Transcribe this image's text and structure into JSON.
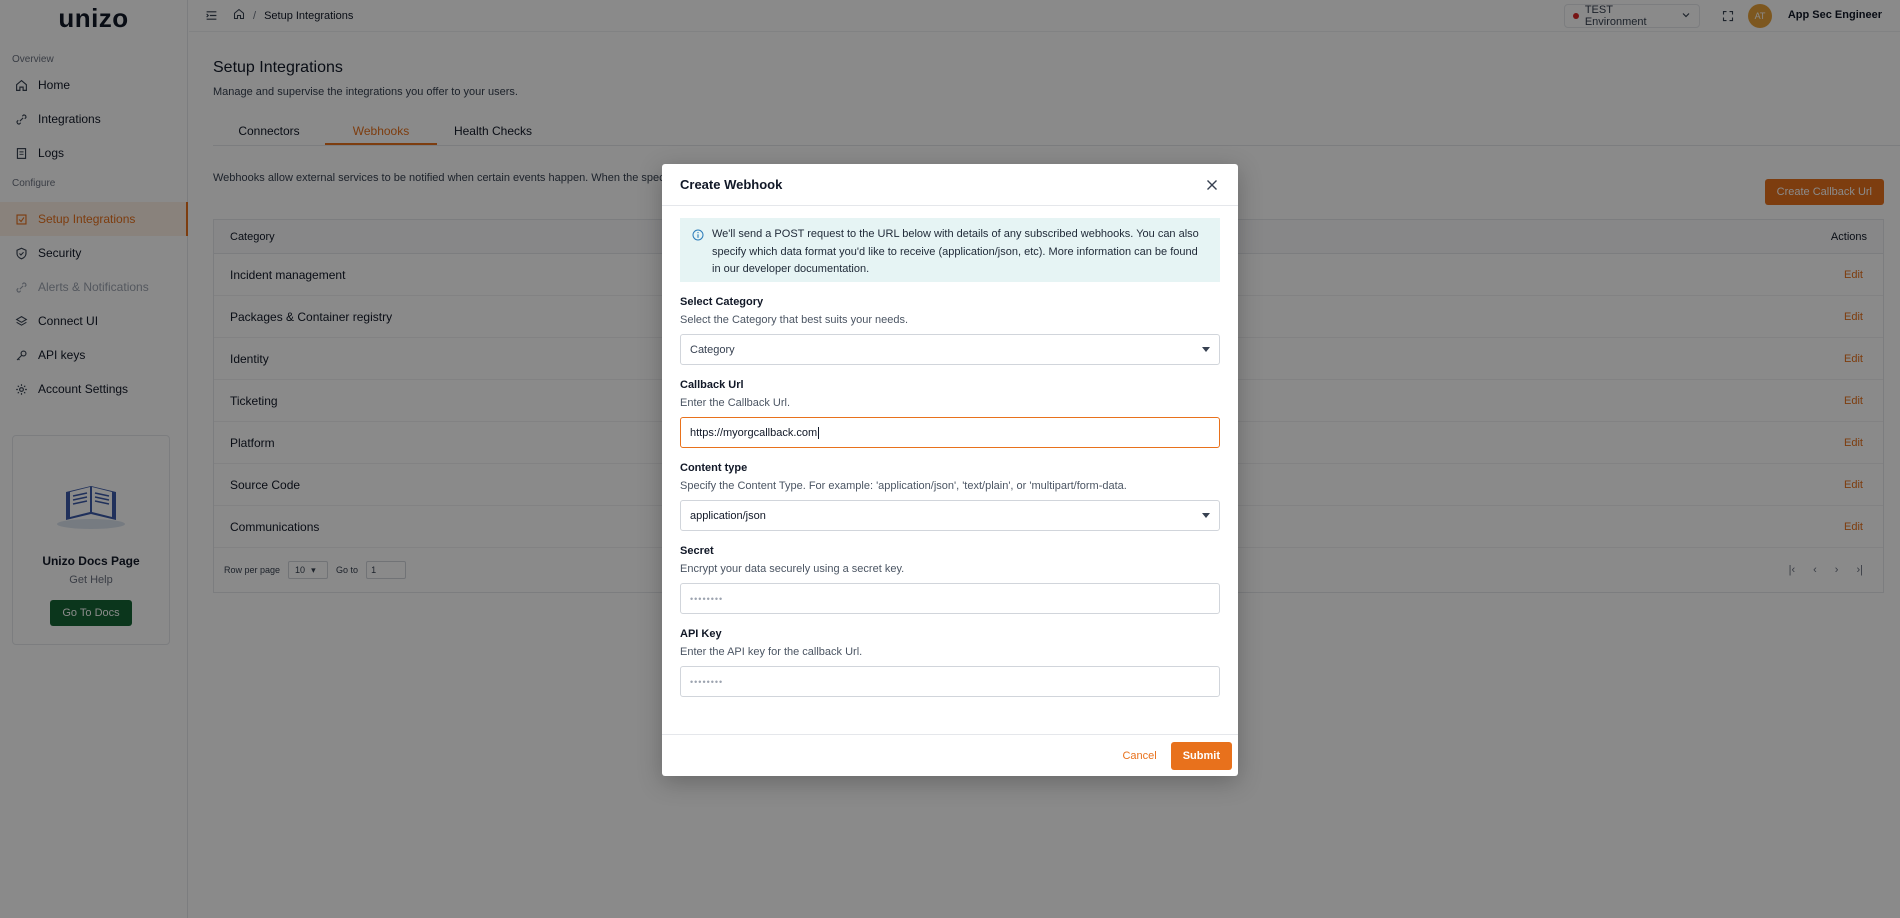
{
  "app": {
    "logo": "unizo"
  },
  "sidebar": {
    "sections": [
      {
        "label": "Overview"
      },
      {
        "label": "Configure"
      }
    ],
    "items": [
      {
        "label": "Home",
        "icon": "home-icon"
      },
      {
        "label": "Integrations",
        "icon": "link-icon"
      },
      {
        "label": "Logs",
        "icon": "logs-icon"
      },
      {
        "label": "Setup Integrations",
        "icon": "setup-icon",
        "active": true
      },
      {
        "label": "Security",
        "icon": "shield-icon"
      },
      {
        "label": "Alerts & Notifications",
        "icon": "bell-icon",
        "disabled": true
      },
      {
        "label": "Connect UI",
        "icon": "layers-icon"
      },
      {
        "label": "API keys",
        "icon": "key-icon"
      },
      {
        "label": "Account Settings",
        "icon": "gear-icon"
      }
    ],
    "docs": {
      "title": "Unizo Docs Page",
      "subtitle": "Get Help",
      "button": "Go To Docs"
    }
  },
  "topbar": {
    "breadcrumb": "Setup Integrations",
    "environment": "TEST Environment",
    "avatar_initials": "AT",
    "user_name": "App Sec Engineer"
  },
  "main": {
    "title": "Setup Integrations",
    "subtitle": "Manage and supervise the integrations you offer to your users.",
    "tabs": [
      {
        "label": "Connectors"
      },
      {
        "label": "Webhooks",
        "active": true
      },
      {
        "label": "Health Checks"
      }
    ],
    "description": "Webhooks allow external services to be notified when certain events happen. When the spec",
    "create_button": "Create Callback Url",
    "table": {
      "headers": {
        "category": "Category",
        "actions": "Actions"
      },
      "rows": [
        {
          "category": "Incident management",
          "action": "Edit"
        },
        {
          "category": "Packages & Container registry",
          "action": "Edit"
        },
        {
          "category": "Identity",
          "action": "Edit"
        },
        {
          "category": "Ticketing",
          "action": "Edit"
        },
        {
          "category": "Platform",
          "action": "Edit"
        },
        {
          "category": "Source Code",
          "action": "Edit"
        },
        {
          "category": "Communications",
          "action": "Edit"
        }
      ],
      "pager": {
        "rows_label": "Row per page",
        "rows_value": "10",
        "goto_label": "Go to",
        "goto_value": "1"
      }
    }
  },
  "modal": {
    "title": "Create Webhook",
    "info": "We'll send a POST request to the URL below with details of any subscribed webhooks. You can also specify which data format you'd like to receive (application/json, etc). More information can be found in our developer documentation.",
    "category": {
      "label": "Select Category",
      "help": "Select the Category that best suits your needs.",
      "placeholder": "Category"
    },
    "callback": {
      "label": "Callback Url",
      "help": "Enter the Callback Url.",
      "value": "https://myorgcallback.com"
    },
    "content_type": {
      "label": "Content type",
      "help": "Specify the Content Type. For example: 'application/json', 'text/plain', or 'multipart/form-data.",
      "value": "application/json"
    },
    "secret": {
      "label": "Secret",
      "help": "Encrypt your data securely using a secret key.",
      "placeholder": "••••••••"
    },
    "api_key": {
      "label": "API Key",
      "help": "Enter the API key for the callback Url.",
      "placeholder": "••••••••"
    },
    "cancel": "Cancel",
    "submit": "Submit"
  },
  "colors": {
    "accent": "#e8711c",
    "docs_button": "#166534",
    "info_bg": "#e6f4f4"
  }
}
